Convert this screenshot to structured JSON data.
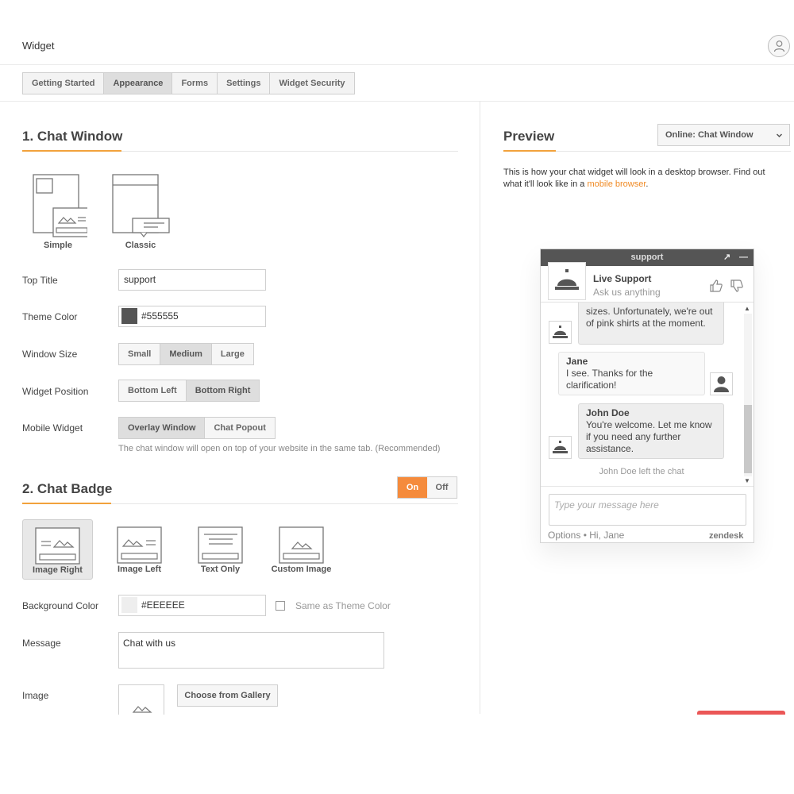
{
  "app": {
    "title": "Widget"
  },
  "tabs": [
    "Getting Started",
    "Appearance",
    "Forms",
    "Settings",
    "Widget Security"
  ],
  "chat_window": {
    "title": "1. Chat Window",
    "layouts": [
      "Simple",
      "Classic"
    ],
    "top_title_label": "Top Title",
    "top_title_value": "support",
    "theme_color_label": "Theme Color",
    "theme_color_value": "#555555",
    "window_size_label": "Window Size",
    "window_sizes": [
      "Small",
      "Medium",
      "Large"
    ],
    "window_size_selected": "Medium",
    "widget_position_label": "Widget Position",
    "positions": [
      "Bottom Left",
      "Bottom Right"
    ],
    "position_selected": "Bottom Right",
    "mobile_widget_label": "Mobile Widget",
    "mobile_options": [
      "Overlay Window",
      "Chat Popout"
    ],
    "mobile_selected": "Overlay Window",
    "mobile_help": "The chat window will open on top of your website in the same tab. (Recommended)"
  },
  "chat_badge": {
    "title": "2. Chat Badge",
    "toggle_on": "On",
    "toggle_off": "Off",
    "styles": [
      "Image Right",
      "Image Left",
      "Text Only",
      "Custom Image"
    ],
    "style_selected": "Image Right",
    "background_color_label": "Background Color",
    "background_color_value": "#EEEEEE",
    "same_as_theme_label": "Same as Theme Color",
    "message_label": "Message",
    "message_value": "Chat with us",
    "image_label": "Image",
    "gallery_button": "Choose from Gallery"
  },
  "preview": {
    "title": "Preview",
    "select_value": "Online: Chat Window",
    "desc_text": "This is how your chat widget will look in a desktop browser. Find out what it'll look like in a ",
    "desc_link": "mobile browser",
    "desc_end": "."
  },
  "chat": {
    "header": "support",
    "agent_name": "Live Support",
    "agent_tagline": "Ask us anything",
    "msg1": "sizes. Unfortunately, we're out of pink shirts at the moment.",
    "msg2_name": "Jane",
    "msg2_text": "I see. Thanks for the clarification!",
    "msg3_name": "John Doe",
    "msg3_text": "You're welcome. Let me know if you need any further assistance.",
    "left_note": "John Doe left the chat",
    "input_placeholder": "Type your message here",
    "footer_left": "Options • Hi, Jane",
    "footer_brand": "zendesk"
  },
  "colors": {
    "accent": "#f58b3c",
    "theme": "#555555",
    "badge_bg": "#EEEEEE",
    "link": "#f08a24"
  },
  "icons": [
    "user-icon",
    "service-bell-icon",
    "thumbs-up-icon",
    "thumbs-down-icon",
    "popout-icon",
    "minimize-icon",
    "image-icon",
    "chevron-down-icon"
  ]
}
